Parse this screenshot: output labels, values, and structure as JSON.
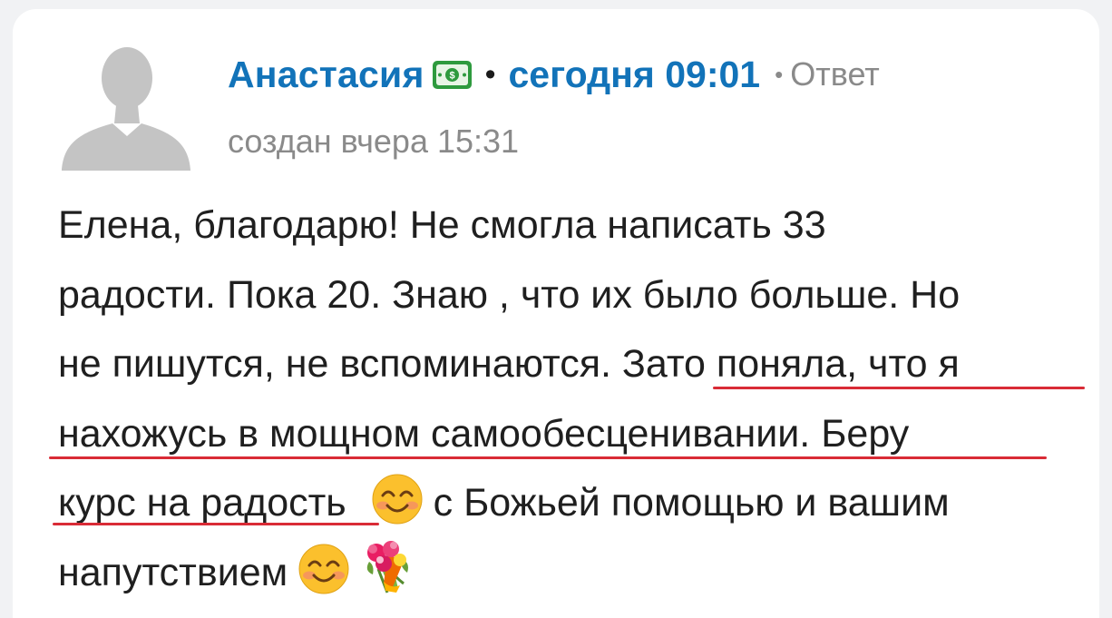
{
  "comment": {
    "author": "Анастасия",
    "separator": "•",
    "time": "сегодня 09:01",
    "reply_separator": "•",
    "reply_label": "Ответ",
    "created": "создан вчера 15:31",
    "body_lines": [
      "Елена, благодарю! Не смогла написать 33",
      "радости. Пока 20. Знаю , что их было больше. Но",
      "не пишутся, не вспоминаются. Зато поняла, что я",
      "нахожусь в мощном самообесценивании. Беру",
      "курс на радость",
      " с Божьей помощью и вашим",
      "напутствием"
    ],
    "icons": {
      "avatar": "default-user-avatar-icon",
      "badge": "money-badge-icon",
      "emoji_smile": "smiling-face-emoji",
      "emoji_flowers": "bouquet-emoji"
    }
  },
  "colors": {
    "accent": "#1273b9",
    "muted": "#8a8a8a",
    "text": "#1f1f1f",
    "underline": "#d92b36",
    "badge": "#2e9a3e"
  }
}
